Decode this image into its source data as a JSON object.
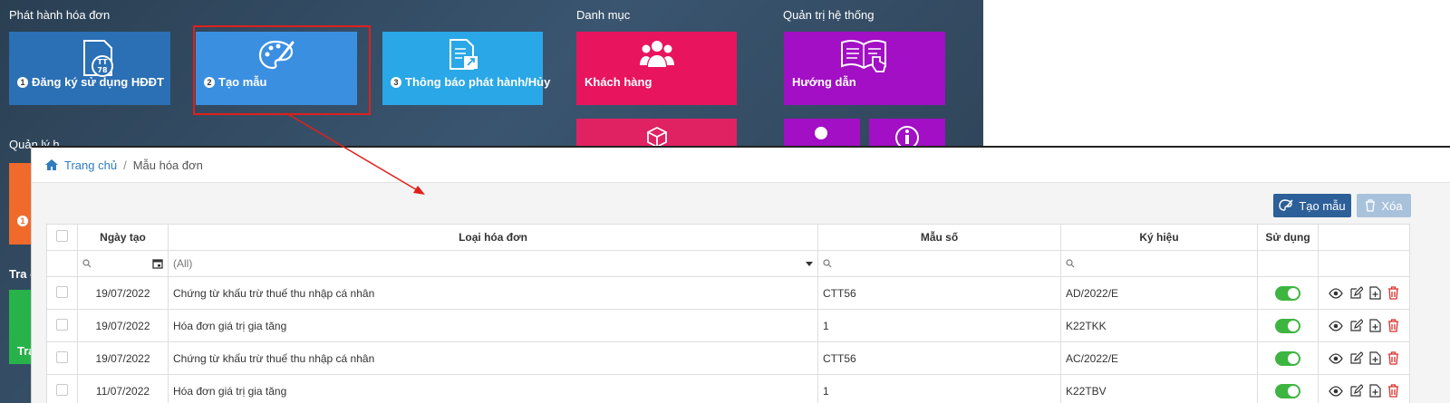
{
  "dashboard": {
    "sections": {
      "issue": "Phát hành hóa đơn",
      "catalog": "Danh mục",
      "admin": "Quản trị hệ thống",
      "manage_partial": "Quản lý h",
      "lookup_partial": "Tra c"
    },
    "tiles": {
      "register": {
        "num": "1",
        "label": "Đăng ký sử dụng HĐĐT",
        "icon_text": "TT\n78",
        "color": "#2b6fb5"
      },
      "template": {
        "num": "2",
        "label": "Tạo mẫu",
        "color": "#3b8fe0"
      },
      "notice": {
        "num": "3",
        "label": "Thông báo phát hành/Hủy",
        "color": "#2aa7e6"
      },
      "customer": {
        "label": "Khách hàng",
        "color": "#e8145e"
      },
      "guide": {
        "label": "Hướng dẫn",
        "color": "#a20fc4"
      },
      "orange_num": "1",
      "green_partial": "Tra"
    }
  },
  "breadcrumb": {
    "home": "Trang chủ",
    "separator": "/",
    "current": "Mẫu hóa đơn"
  },
  "toolbar": {
    "create": "Tạo mẫu",
    "delete": "Xóa"
  },
  "table": {
    "columns": {
      "date": "Ngày tạo",
      "type": "Loại hóa đơn",
      "form": "Mẫu số",
      "symbol": "Ký hiệu",
      "use": "Sử dụng"
    },
    "filter": {
      "type_all": "(All)"
    },
    "rows": [
      {
        "date": "19/07/2022",
        "type": "Chứng từ khấu trừ thuế thu nhập cá nhân",
        "form": "CTT56",
        "symbol": "AD/2022/E",
        "active": true
      },
      {
        "date": "19/07/2022",
        "type": "Hóa đơn giá trị gia tăng",
        "form": "1",
        "symbol": "K22TKK",
        "active": true
      },
      {
        "date": "19/07/2022",
        "type": "Chứng từ khấu trừ thuế thu nhập cá nhân",
        "form": "CTT56",
        "symbol": "AC/2022/E",
        "active": true
      },
      {
        "date": "11/07/2022",
        "type": "Hóa đơn giá trị gia tăng",
        "form": "1",
        "symbol": "K22TBV",
        "active": true
      }
    ]
  },
  "colors": {
    "primary": "#2d5f98",
    "link": "#2f7cc0",
    "toggle": "#3eb541",
    "delete_icon": "#d9302c",
    "highlight": "#e0201a"
  }
}
